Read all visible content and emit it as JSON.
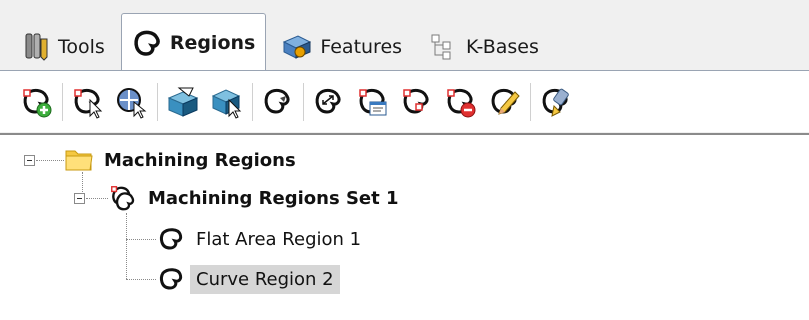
{
  "tabs": [
    {
      "label": "Tools",
      "icon": "tools-icon",
      "active": false
    },
    {
      "label": "Regions",
      "icon": "regions-icon",
      "active": true
    },
    {
      "label": "Features",
      "icon": "features-icon",
      "active": false
    },
    {
      "label": "K-Bases",
      "icon": "kbases-icon",
      "active": false
    }
  ],
  "toolbar": {
    "buttons": [
      "add-region-icon",
      "select-region-icon",
      "region-tool-icon",
      "feature-region-icon",
      "feature-select-icon",
      "region-outline-icon",
      "region-transform-icon",
      "region-properties-icon",
      "region-merge-icon",
      "region-delete-icon",
      "region-edit-icon",
      "region-paint-icon"
    ]
  },
  "tree": {
    "root": {
      "label": "Machining Regions",
      "icon": "folder-icon"
    },
    "set": {
      "label": "Machining Regions Set 1",
      "icon": "regions-set-icon"
    },
    "items": [
      {
        "label": "Flat Area Region 1",
        "icon": "region-icon",
        "selected": false
      },
      {
        "label": "Curve Region 2",
        "icon": "region-icon",
        "selected": true
      }
    ]
  },
  "colors": {
    "tab_border": "#9aa4b3",
    "selection": "#d6d6d6",
    "folder": "#f5c842",
    "accent_red": "#e03030"
  }
}
